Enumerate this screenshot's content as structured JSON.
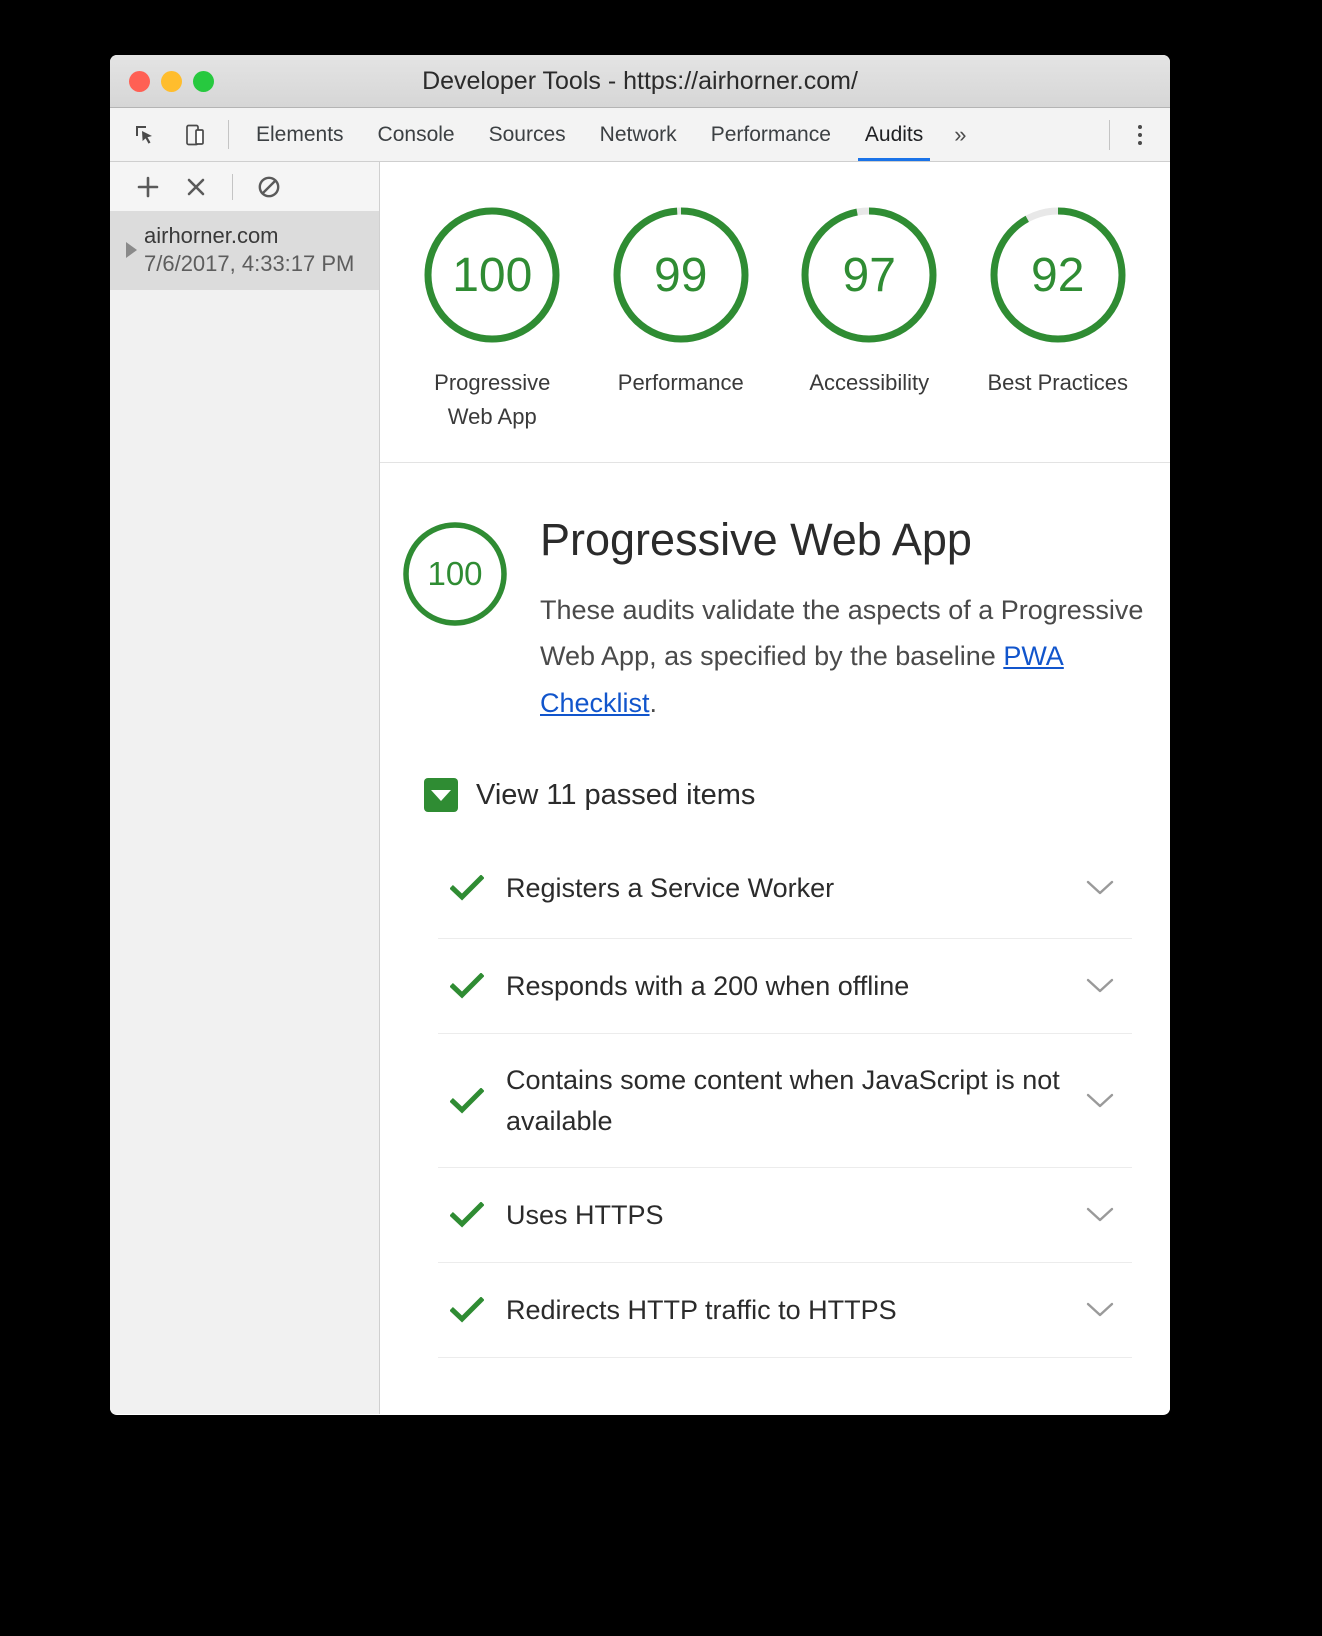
{
  "window": {
    "title": "Developer Tools - https://airhorner.com/",
    "traffic_lights": [
      {
        "name": "close",
        "color": "#ff6054"
      },
      {
        "name": "minimize",
        "color": "#ffbd2d"
      },
      {
        "name": "zoom",
        "color": "#27c93f"
      }
    ]
  },
  "toolbar": {
    "icons": [
      {
        "name": "inspect-element-icon"
      },
      {
        "name": "device-toolbar-icon"
      }
    ],
    "tabs": [
      {
        "label": "Elements",
        "active": false
      },
      {
        "label": "Console",
        "active": false
      },
      {
        "label": "Sources",
        "active": false
      },
      {
        "label": "Network",
        "active": false
      },
      {
        "label": "Performance",
        "active": false
      },
      {
        "label": "Audits",
        "active": true
      }
    ],
    "more_tabs_label": "»",
    "menu_label": "More options"
  },
  "sidebar": {
    "actions": [
      {
        "name": "add-audit-button",
        "glyph": "+"
      },
      {
        "name": "clear-audit-button",
        "glyph": "×"
      },
      {
        "name": "block-requests-button",
        "glyph": "⊘"
      }
    ],
    "runs": [
      {
        "name": "airhorner.com",
        "date": "7/6/2017, 4:33:17 PM",
        "selected": true
      }
    ]
  },
  "scores": [
    {
      "label": "Progressive Web App",
      "value": 100
    },
    {
      "label": "Performance",
      "value": 99
    },
    {
      "label": "Accessibility",
      "value": 97
    },
    {
      "label": "Best Practices",
      "value": 92
    }
  ],
  "category": {
    "score": 100,
    "title": "Progressive Web App",
    "description_before": "These audits validate the aspects of a Progressive Web App, as specified by the baseline ",
    "link_text": "PWA Checklist",
    "description_after": "."
  },
  "passed": {
    "toggle_label": "View 11 passed items",
    "count": 11,
    "expanded": true
  },
  "audits": [
    {
      "title": "Registers a Service Worker",
      "status": "pass"
    },
    {
      "title": "Responds with a 200 when offline",
      "status": "pass"
    },
    {
      "title": "Contains some content when JavaScript is not available",
      "status": "pass"
    },
    {
      "title": "Uses HTTPS",
      "status": "pass"
    },
    {
      "title": "Redirects HTTP traffic to HTTPS",
      "status": "pass"
    }
  ],
  "colors": {
    "pass_green": "#2f8c33",
    "gauge_track": "#e8e8e8",
    "link_blue": "#1155cc",
    "tab_accent": "#1a73e8"
  }
}
